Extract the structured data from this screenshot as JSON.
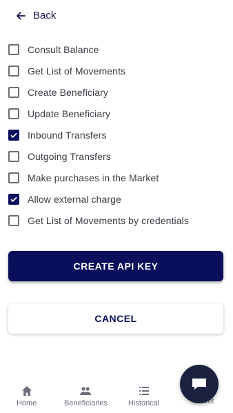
{
  "header": {
    "back_label": "Back"
  },
  "permissions": [
    {
      "label": "Consult Balance",
      "checked": false
    },
    {
      "label": "Get List of Movements",
      "checked": false
    },
    {
      "label": "Create Beneficiary",
      "checked": false
    },
    {
      "label": "Update Beneficiary",
      "checked": false
    },
    {
      "label": "Inbound Transfers",
      "checked": true
    },
    {
      "label": "Outgoing Transfers",
      "checked": false
    },
    {
      "label": "Make purchases in the Market",
      "checked": false
    },
    {
      "label": "Allow external charge",
      "checked": true
    },
    {
      "label": "Get List of Movements by credentials",
      "checked": false
    }
  ],
  "actions": {
    "create_label": "CREATE API KEY",
    "cancel_label": "CANCEL"
  },
  "nav": {
    "items": [
      {
        "label": "Home",
        "icon": "home-icon"
      },
      {
        "label": "Beneficiaries",
        "icon": "people-icon"
      },
      {
        "label": "Historical",
        "icon": "list-icon"
      },
      {
        "label": "Market",
        "icon": "market-icon"
      }
    ]
  },
  "colors": {
    "primary": "#0a0f5c",
    "fab": "#1c2140"
  }
}
